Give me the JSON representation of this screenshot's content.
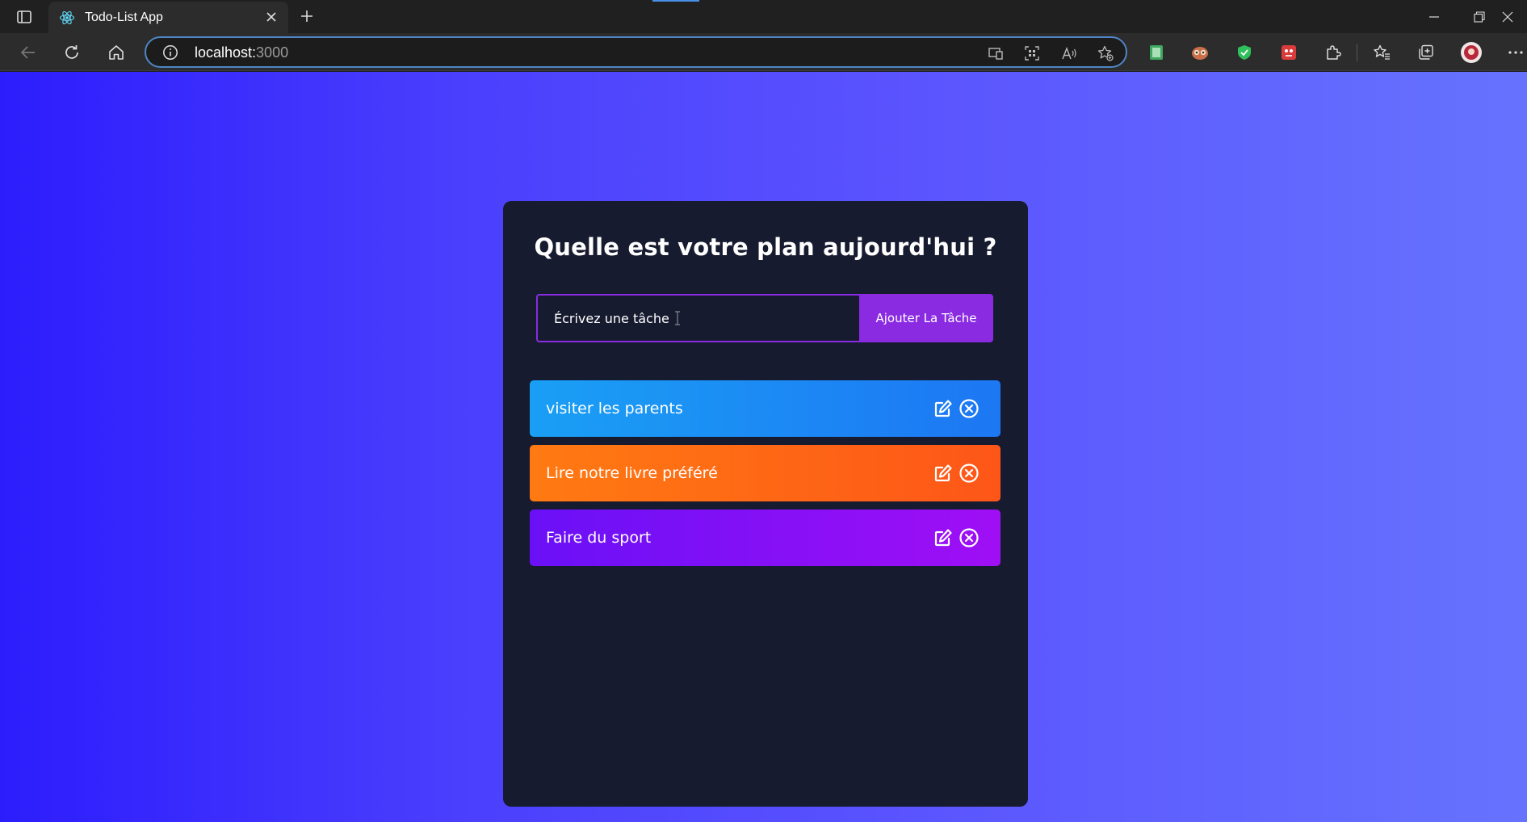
{
  "browser": {
    "tab_title": "Todo-List App",
    "url_host": "localhost:",
    "url_port": "3000"
  },
  "app": {
    "heading": "Quelle est votre plan aujourd'hui ?",
    "input_placeholder": "Écrivez une tâche",
    "add_button_label": "Ajouter La Tâche",
    "todos": [
      {
        "text": "visiter les parents",
        "color_from": "#1a9ff5",
        "color_to": "#1d77f3"
      },
      {
        "text": "Lire notre livre préféré",
        "color_from": "#ff7a12",
        "color_to": "#fe5618"
      },
      {
        "text": "Faire du sport",
        "color_from": "#6a10f7",
        "color_to": "#9f0ff5"
      }
    ]
  },
  "colors": {
    "accent": "#8a2be2",
    "card_bg": "#171b30"
  }
}
